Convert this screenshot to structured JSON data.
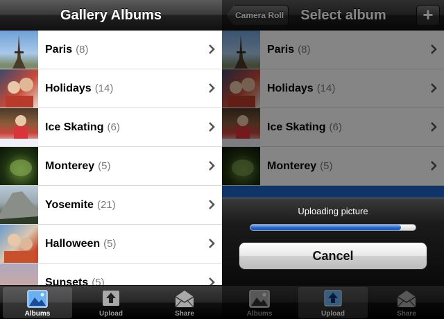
{
  "left": {
    "title": "Gallery Albums",
    "albums": [
      {
        "name": "Paris",
        "count": "(8)"
      },
      {
        "name": "Holidays",
        "count": "(14)"
      },
      {
        "name": "Ice Skating",
        "count": "(6)"
      },
      {
        "name": "Monterey",
        "count": "(5)"
      },
      {
        "name": "Yosemite",
        "count": "(21)"
      },
      {
        "name": "Halloween",
        "count": "(5)"
      },
      {
        "name": "Sunsets",
        "count": "(5)"
      }
    ],
    "tabs": [
      {
        "label": "Albums",
        "icon": "albums-icon",
        "selected": true
      },
      {
        "label": "Upload",
        "icon": "upload-icon",
        "selected": false
      },
      {
        "label": "Share",
        "icon": "share-icon",
        "selected": false
      }
    ]
  },
  "right": {
    "back_label": "Camera Roll",
    "title": "Select album",
    "add_label": "+",
    "albums": [
      {
        "name": "Paris",
        "count": "(8)"
      },
      {
        "name": "Holidays",
        "count": "(14)"
      },
      {
        "name": "Ice Skating",
        "count": "(6)"
      },
      {
        "name": "Monterey",
        "count": "(5)"
      }
    ],
    "upload_label": "Uploading picture",
    "progress": 0.91,
    "cancel_label": "Cancel",
    "tabs": [
      {
        "label": "Albums",
        "icon": "albums-icon",
        "selected": false
      },
      {
        "label": "Upload",
        "icon": "upload-icon",
        "selected": true
      },
      {
        "label": "Share",
        "icon": "share-icon",
        "selected": false
      }
    ]
  },
  "colors": {
    "selection_blue": "#1d64c8",
    "progress_blue": "#2a6ad0"
  }
}
